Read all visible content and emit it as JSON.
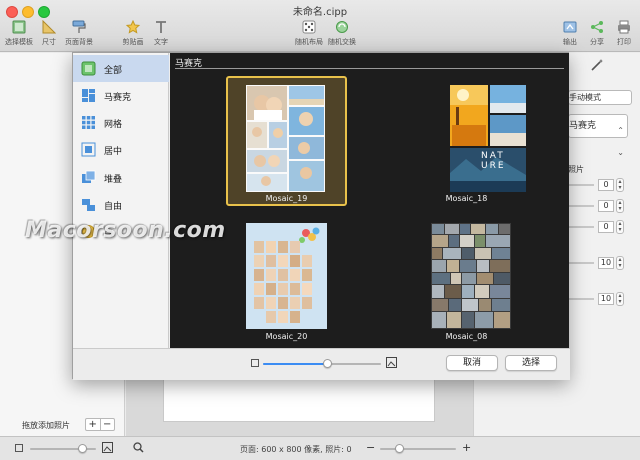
{
  "window": {
    "title": "未命名.cipp"
  },
  "toolbar": {
    "left": [
      {
        "label": "选择模板",
        "icon": "template-icon"
      },
      {
        "label": "尺寸",
        "icon": "ruler-icon"
      },
      {
        "label": "页面背景",
        "icon": "paint-roller-icon"
      },
      {
        "label": "剪贴画",
        "icon": "star-icon"
      },
      {
        "label": "文字",
        "icon": "text-icon"
      }
    ],
    "center": [
      {
        "label": "随机布局",
        "icon": "dice-icon"
      },
      {
        "label": "随机交换",
        "icon": "shuffle-icon"
      }
    ],
    "right": [
      {
        "label": "输出",
        "icon": "export-icon"
      },
      {
        "label": "分享",
        "icon": "share-icon"
      },
      {
        "label": "打印",
        "icon": "print-icon"
      }
    ]
  },
  "dialog": {
    "categories": [
      {
        "label": "全部",
        "icon": "all-icon",
        "selected": true
      },
      {
        "label": "马赛克",
        "icon": "mosaic-icon",
        "selected": false
      },
      {
        "label": "网格",
        "icon": "grid-icon",
        "selected": false
      },
      {
        "label": "居中",
        "icon": "center-icon",
        "selected": false
      },
      {
        "label": "堆叠",
        "icon": "stack-icon",
        "selected": false
      },
      {
        "label": "自由",
        "icon": "freeform-icon",
        "selected": false
      },
      {
        "label": "自",
        "icon": "custom-icon",
        "selected": false
      }
    ],
    "section_title": "马赛克",
    "templates": [
      {
        "name": "Mosaic_19",
        "selected": true
      },
      {
        "name": "Mosaic_18",
        "selected": false
      },
      {
        "name": "Mosaic_20",
        "selected": false
      },
      {
        "name": "Mosaic_08",
        "selected": false
      }
    ],
    "nature_text": {
      "line1": "NAT",
      "line2": "URE"
    },
    "zoom_level": 0.55,
    "cancel_label": "取消",
    "choose_label": "选择"
  },
  "inspector": {
    "mode_label": "手动模式",
    "layout_select": "马赛克",
    "photos_label": "照片",
    "steppers": [
      {
        "value": "0"
      },
      {
        "value": "0"
      },
      {
        "value": "0"
      },
      {
        "value": "10"
      },
      {
        "value": "10"
      }
    ]
  },
  "left_panel": {
    "add_photos_label": "拖放添加照片",
    "plus": "+",
    "minus": "−"
  },
  "statusbar": {
    "page_info": "页面: 600 x 800 像素, 照片: 0",
    "minus": "−",
    "plus": "+",
    "thumb_zoom": 0.8,
    "page_zoom": 0.25
  },
  "watermark": "Macorsoon.com",
  "colors": {
    "accent": "#3b8cf3",
    "selection_gold": "#e9c24b",
    "gallery_bg": "#1d1d1d"
  }
}
